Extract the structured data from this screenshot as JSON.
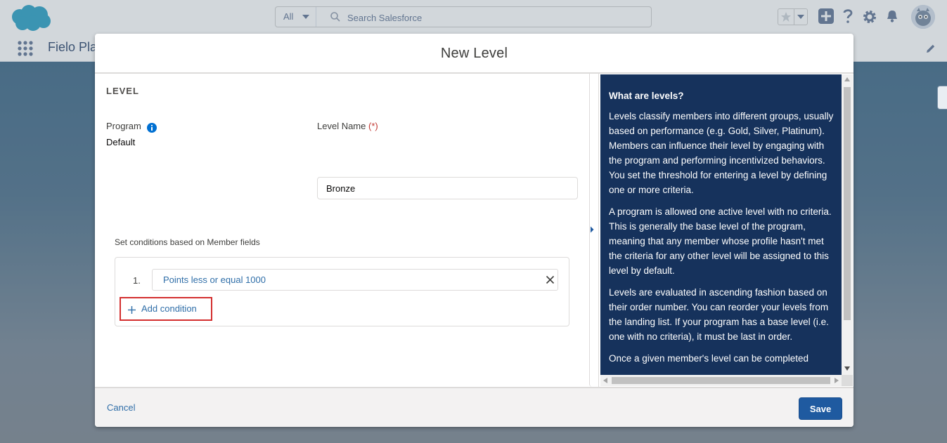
{
  "header": {
    "search_scope": "All",
    "search_placeholder": "Search Salesforce",
    "icons": [
      "salesforce-cloud-logo",
      "caret-down-icon",
      "search-icon",
      "star-icon",
      "plus-icon",
      "help-icon",
      "gear-icon",
      "bell-icon",
      "avatar"
    ]
  },
  "app_bar": {
    "app_name": "Fielo Pla"
  },
  "modal": {
    "title": "New Level",
    "section_title": "LEVEL",
    "program_label": "Program",
    "program_value": "Default",
    "level_name_label": "Level Name",
    "level_name_required": "(*)",
    "level_name_value": "Bronze",
    "conditions_caption": "Set conditions based on Member fields",
    "conditions": [
      {
        "number": "1.",
        "text": "Points less or equal 1000"
      }
    ],
    "add_condition_label": "Add condition",
    "cancel_label": "Cancel",
    "save_label": "Save"
  },
  "help": {
    "title": "What are levels?",
    "paragraphs": [
      "Levels classify members into different groups, usually based on performance (e.g. Gold, Silver, Platinum). Members can influence their level by engaging with the program and performing incentivized behaviors. You set the threshold for entering a level by defining one or more criteria.",
      "A program is allowed one active level with no criteria. This is generally the base level of the program, meaning that any member whose profile hasn't met the criteria for any other level will be assigned to this level by default.",
      "Levels are evaluated in ascending fashion based on their order number. You can reorder your levels from the landing list. If your program has a base level (i.e. one with no criteria), it must be last in order.",
      "Once a given member's level can be completed"
    ]
  },
  "colors": {
    "brand_blue": "#1f5aa0",
    "link_blue": "#2f6ea8",
    "help_panel_bg": "#16325c",
    "highlight_red": "#d32f2f",
    "required_red": "#c23934"
  }
}
